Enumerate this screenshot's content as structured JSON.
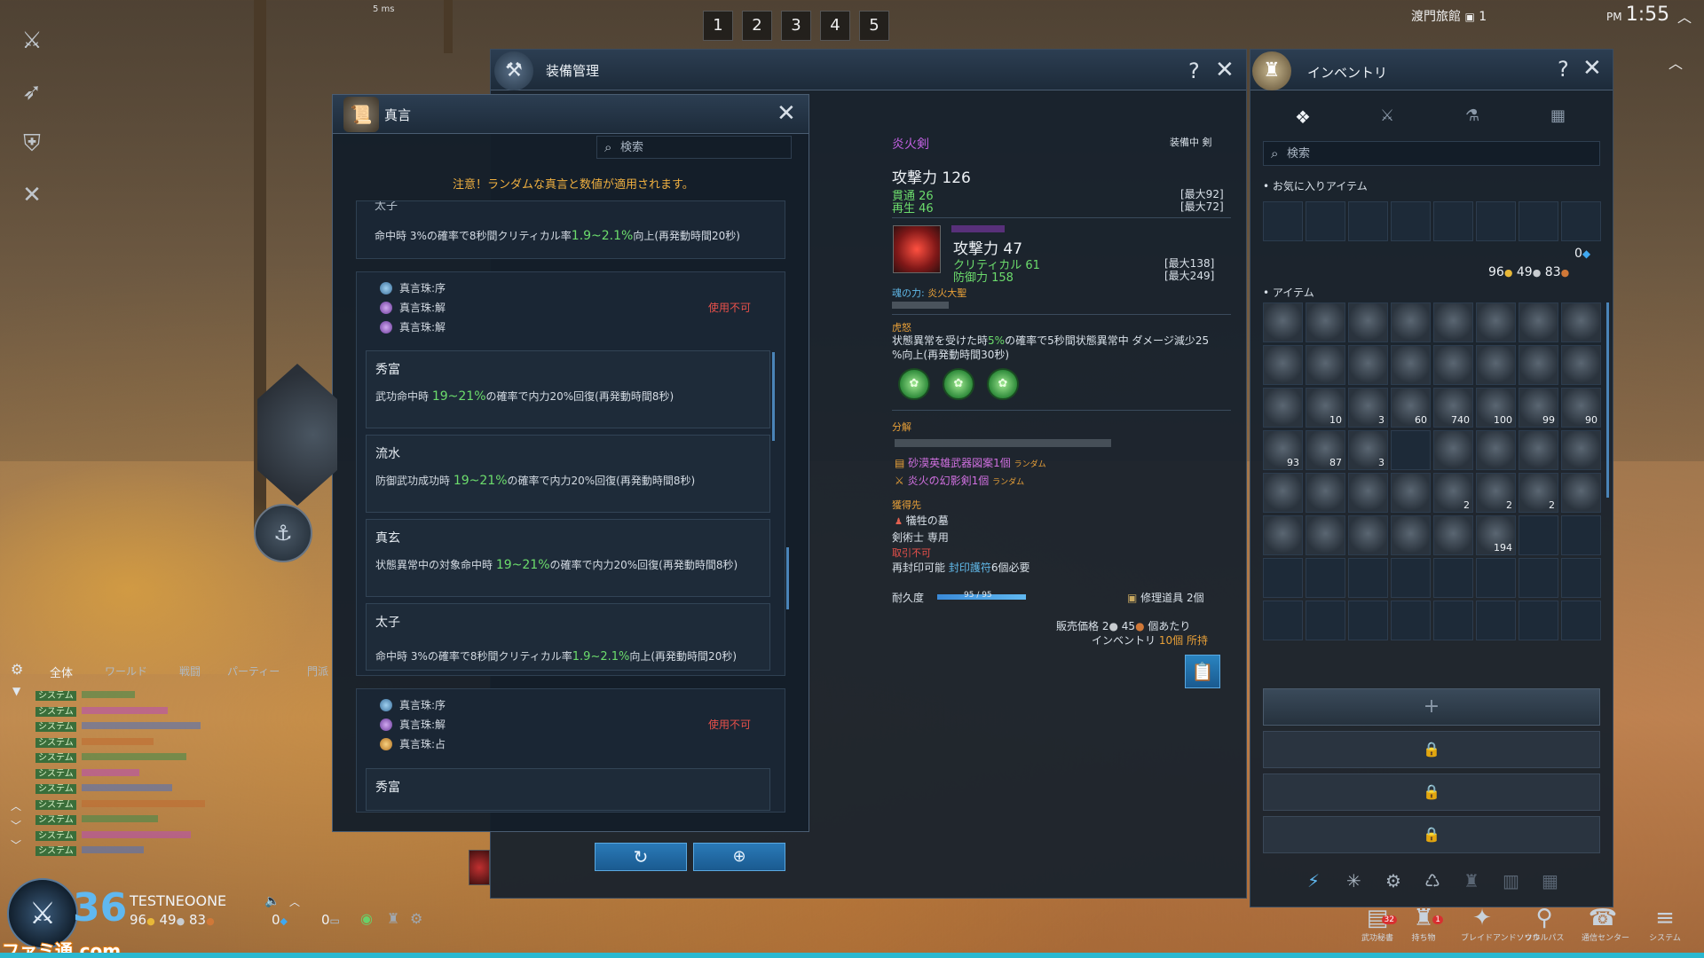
{
  "hud": {
    "ping": "5 ms",
    "hotbar": [
      "1",
      "2",
      "3",
      "4",
      "5"
    ],
    "location": "渡門旅館",
    "location_channel": "1",
    "ampm": "PM",
    "time": "1:55"
  },
  "equip_window": {
    "title": "装備管理"
  },
  "proverb_window": {
    "title": "真言",
    "search_placeholder": "検索",
    "notice": "注意！ランダムな真言と数値が適用されます。",
    "top_fragment": {
      "title": "太子",
      "desc_pre": "命中時  3%の確率で8秒間クリティカル率",
      "desc_hl": "1.9~2.1%",
      "desc_post": "向上(再発動時間20秒)"
    },
    "group1": {
      "sockets": [
        "真言珠:序",
        "真言珠:解",
        "真言珠:解"
      ],
      "status": "使用不可"
    },
    "entries": [
      {
        "title": "秀富",
        "desc_pre": "武功命中時  ",
        "desc_hl": "19~21%",
        "desc_post": "の確率で内力20%回復(再発動時間8秒)"
      },
      {
        "title": "流水",
        "desc_pre": "防御武功成功時  ",
        "desc_hl": "19~21%",
        "desc_post": "の確率で内力20%回復(再発動時間8秒)"
      },
      {
        "title": "真玄",
        "desc_pre": "状態異常中の対象命中時  ",
        "desc_hl": "19~21%",
        "desc_post": "の確率で内力20%回復(再発動時間8秒)"
      },
      {
        "title": "太子",
        "desc_pre": "命中時  3%の確率で8秒間クリティカル率",
        "desc_hl": "1.9~2.1%",
        "desc_post": "向上(再発動時間20秒)"
      }
    ],
    "group2": {
      "sockets": [
        "真言珠:序",
        "真言珠:解",
        "真言珠:占"
      ],
      "status": "使用不可"
    },
    "last_entry_title": "秀富",
    "refresh_icon": "refresh-icon",
    "confirm_icon": "seal-icon"
  },
  "item_detail": {
    "name": "炎火剣",
    "equipped": "装備中  剣",
    "attack_label": "攻撃力",
    "attack_value": "126",
    "pierce": "貫通 26",
    "regen": "再生 46",
    "pierce_max": "[最大92]",
    "regen_max": "[最大72]",
    "soul_attack": "攻撃力 47",
    "soul_crit": "クリティカル 61",
    "soul_def": "防御力 158",
    "soul_crit_max": "[最大138]",
    "soul_def_max": "[最大249]",
    "soul_power_label": "魂の力:",
    "soul_power_value": "炎火大聖",
    "effect_title": "虎怒",
    "effect_desc_pre": "状態異常を受けた時",
    "effect_desc_hl": "5%",
    "effect_desc_post": "の確率で5秒間状態異常中 ダメージ減少25",
    "effect_desc_line2": "%向上(再発動時間30秒)",
    "decompose_title": "分解",
    "decompose_1": "砂漠英雄武器図案1個",
    "decompose_2": "炎火の幻影剣1個",
    "random_tag": "ランダム",
    "acquire_title": "獲得先",
    "acquire_1": "犠牲の墓",
    "acquire_2": "剣術士 専用",
    "untradeable": "取引不可",
    "reseal_pre": "再封印可能",
    "reseal_hl": "封印護符",
    "reseal_post": "6個必要",
    "durability_label": "耐久度",
    "durability_text": "95 / 95",
    "durability_pct": 100,
    "repair": "修理道具 2個",
    "sell_label": "販売価格",
    "sell_silver": "2",
    "sell_copper": "45",
    "sell_suffix": "個あたり",
    "inventory_label": "インベントリ",
    "inventory_count": "10個",
    "inventory_suffix": "所持"
  },
  "inventory": {
    "title": "インベントリ",
    "search_placeholder": "検索",
    "favorites_label": "お気に入りアイテム",
    "items_label": "アイテム",
    "soul_beads": "0",
    "gold": "96",
    "silver": "49",
    "copper": "83",
    "counts": {
      "r2": [
        "",
        "",
        "",
        "",
        "",
        "",
        "",
        ""
      ],
      "r3": [
        "",
        "10",
        "3",
        "60",
        "740",
        "100",
        "99",
        "90"
      ],
      "r4": [
        "93",
        "87",
        "3",
        "",
        "",
        "",
        "",
        ""
      ],
      "r5": [
        "",
        "",
        "",
        "",
        "2",
        "2",
        "2",
        ""
      ],
      "r6": [
        "",
        "",
        "",
        "",
        "",
        "194",
        "",
        ""
      ]
    },
    "add_label": "+"
  },
  "player": {
    "level": "36",
    "name": "TESTNEOONE",
    "gold": "96",
    "silver": "49",
    "copper": "83",
    "beads": "0",
    "points": "0"
  },
  "chat": {
    "tabs": [
      "全体",
      "ワールド",
      "戦闘",
      "パーティー",
      "門派"
    ],
    "tag": "システム",
    "line_count": 11
  },
  "bottom_menu": [
    {
      "label": "武功秘書",
      "badge": "32"
    },
    {
      "label": "持ち物",
      "badge": "1"
    },
    {
      "label": "ブレイドアンドソウル",
      "badge": ""
    },
    {
      "label": "ソウルパス",
      "badge": ""
    },
    {
      "label": "通信センター",
      "badge": ""
    },
    {
      "label": "システム",
      "badge": ""
    }
  ],
  "watermark": "ファミ通.com"
}
